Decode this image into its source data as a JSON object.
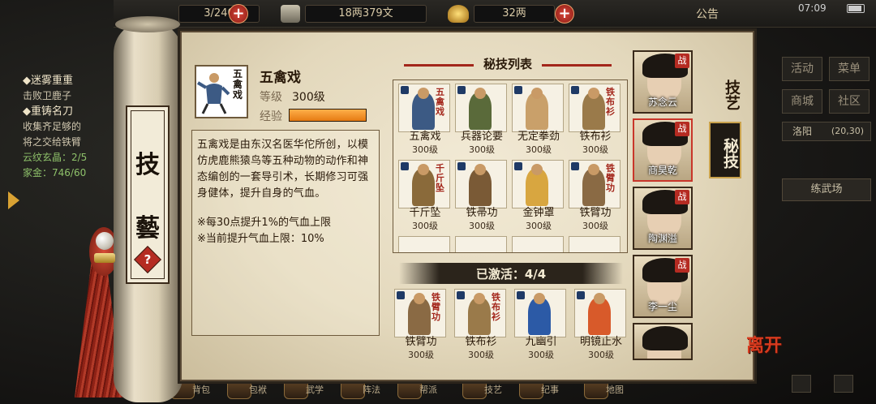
{
  "topbar": {
    "res1": "3/240",
    "res2": "18两379文",
    "res3": "32两",
    "notice": "公告",
    "time": "07:09"
  },
  "quest": {
    "q1_title": "◆迷雾重重",
    "q1_desc": "击败卫鹿子",
    "q2_title": "◆重铸名刀",
    "q2_desc1": "收集齐足够的",
    "q2_desc2": "将之交给铁臂",
    "q2_prog1": "云纹玄晶：2/5",
    "q2_prog2": "家金：746/60"
  },
  "right_menu": {
    "activity": "活动",
    "menu": "菜单",
    "mall": "商城",
    "community": "社区",
    "location": "洛阳",
    "coords": "(20,30)",
    "field": "练武场"
  },
  "bottom_labels": [
    "背包",
    "包袱",
    "武学",
    "阵法",
    "帮派",
    "技艺",
    "纪事",
    "地图"
  ],
  "panel": {
    "title_top": "技",
    "title_bottom": "藝",
    "help": "?",
    "tab_skill_art": "技艺",
    "tab_secret": "秘技",
    "leave": "离开"
  },
  "skill": {
    "name": "五禽戏",
    "icon_text": "五禽戏",
    "level_label": "等级",
    "level_value": "300级",
    "exp_label": "经验",
    "exp_fill_fraction": 1.0,
    "description": "五禽戏是由东汉名医华佗所创，以模仿虎鹿熊猿鸟等五种动物的动作和神态编创的一套导引术，长期修习可强身健体，提升自身的气血。",
    "note1": "※每30点提升1%的气血上限",
    "note2": "※当前提升气血上限：10%"
  },
  "list": {
    "title": "秘技列表",
    "items": [
      {
        "name": "五禽戏",
        "level": "300级",
        "cal": "五禽戏",
        "color": "#3c5a84"
      },
      {
        "name": "兵器论要",
        "level": "300级",
        "cal": "",
        "color": "#5a6a3a"
      },
      {
        "name": "无定拳劲",
        "level": "300级",
        "cal": "",
        "color": "#c9a06a"
      },
      {
        "name": "铁布衫",
        "level": "300级",
        "cal": "铁布衫",
        "color": "#9a7a4a"
      },
      {
        "name": "千斤坠",
        "level": "300级",
        "cal": "千斤坠",
        "color": "#8a6a3a"
      },
      {
        "name": "铁帚功",
        "level": "300级",
        "cal": "",
        "color": "#7a5a36"
      },
      {
        "name": "金钟罩",
        "level": "300级",
        "cal": "",
        "color": "#d8a640"
      },
      {
        "name": "铁臂功",
        "level": "300级",
        "cal": "铁臂功",
        "color": "#8a6a44"
      }
    ]
  },
  "active": {
    "label": "已激活：4/4",
    "items": [
      {
        "name": "铁臂功",
        "level": "300级",
        "cal": "铁臂功",
        "color": "#8a6a44"
      },
      {
        "name": "铁布衫",
        "level": "300级",
        "cal": "铁布衫",
        "color": "#9a7a4a"
      },
      {
        "name": "九幽引",
        "level": "300级",
        "cal": "",
        "color": "#2c5aa6"
      },
      {
        "name": "明镜止水",
        "level": "300级",
        "cal": "",
        "color": "#d85a2a"
      }
    ]
  },
  "characters": [
    {
      "name": "苏念云",
      "badge": "战"
    },
    {
      "name": "商昊乾",
      "badge": "战"
    },
    {
      "name": "陶渊溢",
      "badge": "战"
    },
    {
      "name": "李一尘",
      "badge": "战"
    },
    {
      "name": "",
      "badge": ""
    }
  ]
}
